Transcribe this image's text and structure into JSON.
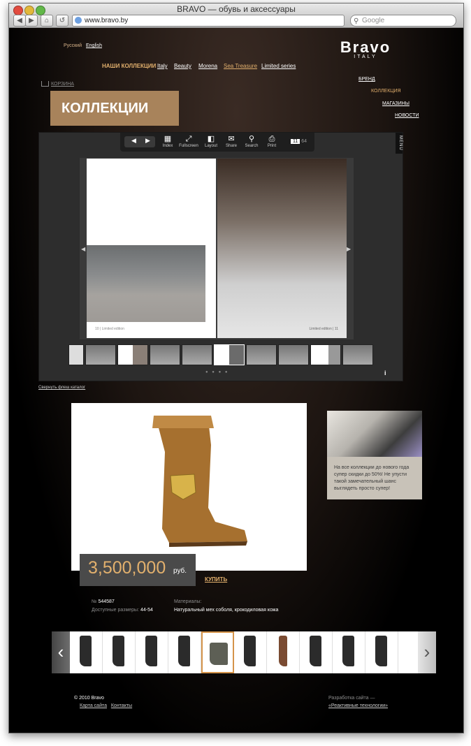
{
  "browser": {
    "window_title": "BRAVO — обувь и аксессуары",
    "url": "www.bravo.by",
    "search_placeholder": "Google",
    "back_glyph": "◀",
    "forward_glyph": "▶",
    "home_glyph": "⌂",
    "reload_glyph": "↺"
  },
  "header": {
    "lang_ru": "Русский",
    "lang_en": "English",
    "logo_main": "Bravo",
    "logo_sub": "ITALY",
    "nav": [
      {
        "label": "НАШИ КОЛЛЕКЦИИ",
        "active": true
      },
      {
        "label": "Italy"
      },
      {
        "label": "Beauty"
      },
      {
        "label": "Morena"
      },
      {
        "label": "Sea Treasure"
      },
      {
        "label": "Limited series"
      }
    ],
    "cart": "КОРЗИНА"
  },
  "side_nav": [
    {
      "label": "БРЕНД"
    },
    {
      "label": "КОЛЛЕКЦИЯ",
      "active": true
    },
    {
      "label": "МАГАЗИНЫ"
    },
    {
      "label": "НОВОСТИ"
    }
  ],
  "section_title": "КОЛЛЕКЦИИ",
  "viewer": {
    "toolbar": [
      {
        "icon": "▦",
        "label": "Index"
      },
      {
        "icon": "⤢",
        "label": "Fullscreen"
      },
      {
        "icon": "◧",
        "label": "Layout"
      },
      {
        "icon": "✉",
        "label": "Share"
      },
      {
        "icon": "⚲",
        "label": "Search"
      },
      {
        "icon": "⎙",
        "label": "Print"
      }
    ],
    "prev_glyph": "◀",
    "next_glyph": "▶",
    "page_current": "11",
    "page_total": "64",
    "menu_label": "MENU",
    "left_page_foot": "10 | Limited edition",
    "right_page_foot": "Limited edition | 11",
    "dots": "● ● ● ●",
    "info": "i"
  },
  "collapse_link": "Свернуть флеш каталог",
  "product": {
    "price": "3,500,000",
    "currency": "руб.",
    "buy": "КУПИТЬ",
    "number_label": "№",
    "number_value": "544587",
    "sizes_label": "Доступные размеры:",
    "sizes_value": "44-54",
    "materials_label": "Материалы:",
    "materials_value": "Натуральный мех соболя, крокодиловая кожа"
  },
  "promo": {
    "text": "На все коллекции до нового года супер скидки до 50%! Не упусти такой замечательный шанс выглядеть просто супер!"
  },
  "carousel": {
    "prev": "‹",
    "next": "›",
    "selected_index": 4
  },
  "footer": {
    "copyright": "© 2010 Bravo",
    "sitemap": "Карта сайта",
    "contacts": "Контакты",
    "dev_label": "Разработка сайта —",
    "dev_link": "«Реактивные технологии»"
  }
}
